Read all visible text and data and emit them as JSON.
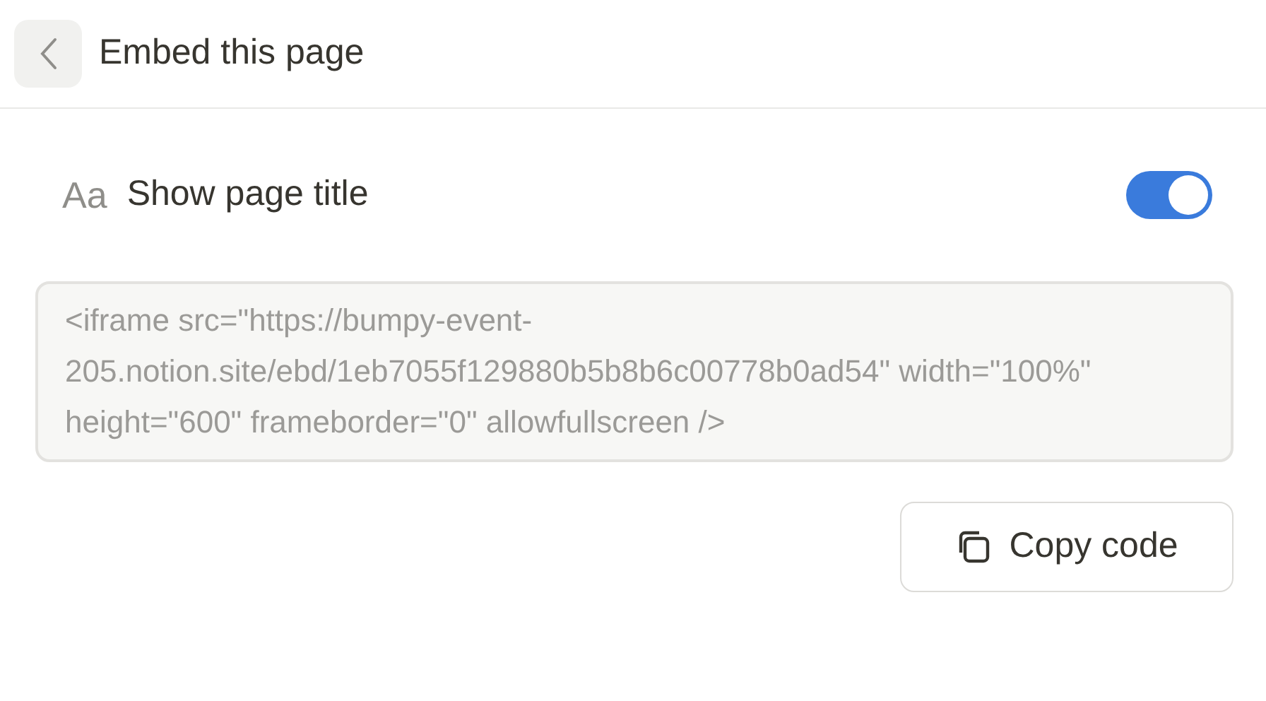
{
  "header": {
    "title": "Embed this page"
  },
  "option": {
    "icon_glyph": "Aa",
    "label": "Show page title",
    "on": true
  },
  "embed_code": "<iframe src=\"https://bumpy-event-205.notion.site/ebd/1eb7055f129880b5b8b6c00778b0ad54\" width=\"100%\" height=\"600\" frameborder=\"0\" allowfullscreen />",
  "copy_button": {
    "label": "Copy code"
  }
}
